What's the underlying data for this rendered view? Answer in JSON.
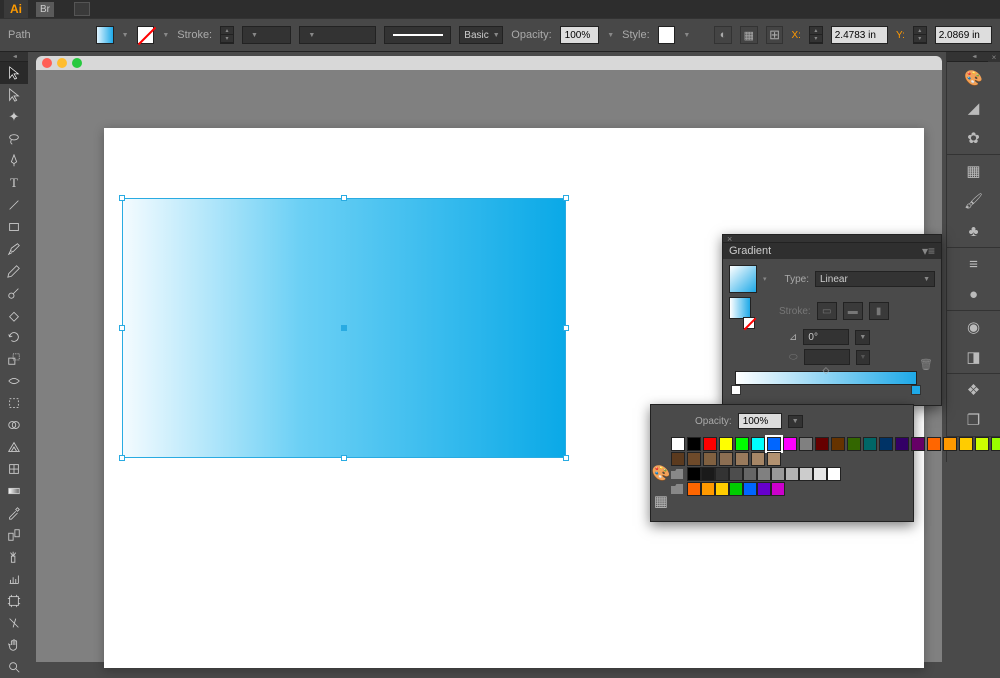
{
  "topbar": {
    "ai": "Ai",
    "br": "Br"
  },
  "controlbar": {
    "path_label": "Path",
    "stroke_label": "Stroke:",
    "basic_label": "Basic",
    "opacity_label": "Opacity:",
    "opacity_value": "100%",
    "style_label": "Style:",
    "x_label": "X:",
    "x_value": "2.4783 in",
    "y_label": "Y:",
    "y_value": "2.0869 in"
  },
  "gradient_panel": {
    "title": "Gradient",
    "type_label": "Type:",
    "type_value": "Linear",
    "stroke_label": "Stroke:",
    "angle_value": "0°"
  },
  "swatch_panel": {
    "opacity_label": "Opacity:",
    "opacity_value": "100%",
    "rows": {
      "row1": [
        "#ffffff",
        "#000000",
        "#ff0000",
        "#ffff00",
        "#00ff00",
        "#00ffff",
        "#0066ff",
        "#ff00ff",
        "#808080",
        "#660000",
        "#663300",
        "#336600",
        "#006666",
        "#003366",
        "#330066",
        "#660066",
        "#ff6600",
        "#ff9900",
        "#ffcc00",
        "#ccff00",
        "#99ff00"
      ],
      "row2": [
        "#5b3a1e",
        "#6e4a2a",
        "#806040",
        "#8c6e52",
        "#997a5c",
        "#a68666",
        "#b39270"
      ],
      "row3": [
        "#000000",
        "#1a1a1a",
        "#333333",
        "#4d4d4d",
        "#666666",
        "#808080",
        "#999999",
        "#b3b3b3",
        "#cccccc",
        "#e6e6e6",
        "#ffffff"
      ],
      "row4": [
        "#ff6600",
        "#ff9900",
        "#ffcc00",
        "#00cc00",
        "#0066ff",
        "#6600cc",
        "#cc00cc"
      ]
    }
  },
  "right_strip_icons": [
    "palette",
    "curve",
    "target",
    "grid",
    "brush",
    "suit",
    "lines",
    "sphere",
    "sun",
    "rect",
    "layers",
    "copy"
  ],
  "toolbox": [
    "select",
    "direct",
    "wand",
    "lasso",
    "pen",
    "type",
    "line",
    "rect2",
    "brush2",
    "pencil",
    "spray",
    "erase",
    "rotate",
    "scale",
    "warp",
    "free",
    "mesh",
    "gradient",
    "eyedrop",
    "blend",
    "sym",
    "graph",
    "art",
    "slice",
    "hand",
    "zoom",
    "fillstroke"
  ]
}
